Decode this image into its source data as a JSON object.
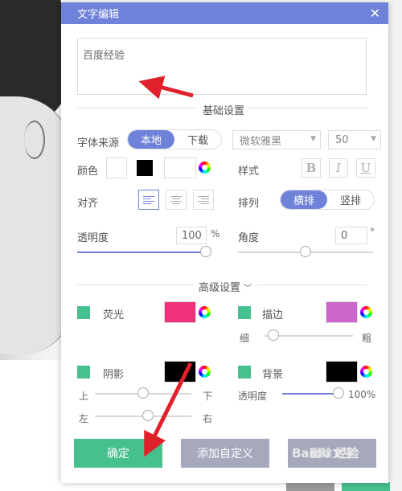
{
  "dialog": {
    "title": "文字编辑",
    "close_icon": "close-icon",
    "text_value": "百度经验"
  },
  "basic": {
    "section_label": "基础设置",
    "font_source_label": "字体来源",
    "font_source_options": [
      "本地",
      "下载"
    ],
    "font_source_selected": "本地",
    "font_family": "微软雅黑",
    "font_size": "50",
    "color_label": "颜色",
    "style_label": "样式",
    "style_buttons": [
      "B",
      "I",
      "U"
    ],
    "align_label": "对齐",
    "arrange_label": "排列",
    "arrange_options": [
      "横排",
      "竖排"
    ],
    "arrange_selected": "横排",
    "opacity_label": "透明度",
    "opacity_value": "100",
    "opacity_unit": "%",
    "opacity_level": 1.0,
    "angle_label": "角度",
    "angle_value": "0",
    "angle_unit": "°",
    "angle_level": 0.5
  },
  "advanced": {
    "section_label": "高级设置",
    "glow_label": "荧光",
    "glow_color": "#f0307a",
    "stroke_label": "描边",
    "stroke_color": "#cc66cc",
    "thin_label": "细",
    "thick_label": "粗",
    "stroke_level": 0.1,
    "shadow_label": "阴影",
    "shadow_color": "#000000",
    "background_label": "背景",
    "background_color": "#000000",
    "up_label": "上",
    "down_label": "下",
    "left_label": "左",
    "right_label": "右",
    "shadow_v_level": 0.5,
    "shadow_h_level": 0.55,
    "bg_opacity_label": "透明度",
    "bg_opacity_value": "100%",
    "bg_opacity_level": 1.0
  },
  "footer": {
    "confirm_label": "确定",
    "add_custom_label": "添加自定义",
    "delete_label": "删除文字"
  },
  "colors": {
    "accent": "#6f82d9",
    "confirm": "#46c08e",
    "disabled": "#a6a9bc",
    "annotation": "#e0202a"
  },
  "watermark": "Baidu 经验"
}
